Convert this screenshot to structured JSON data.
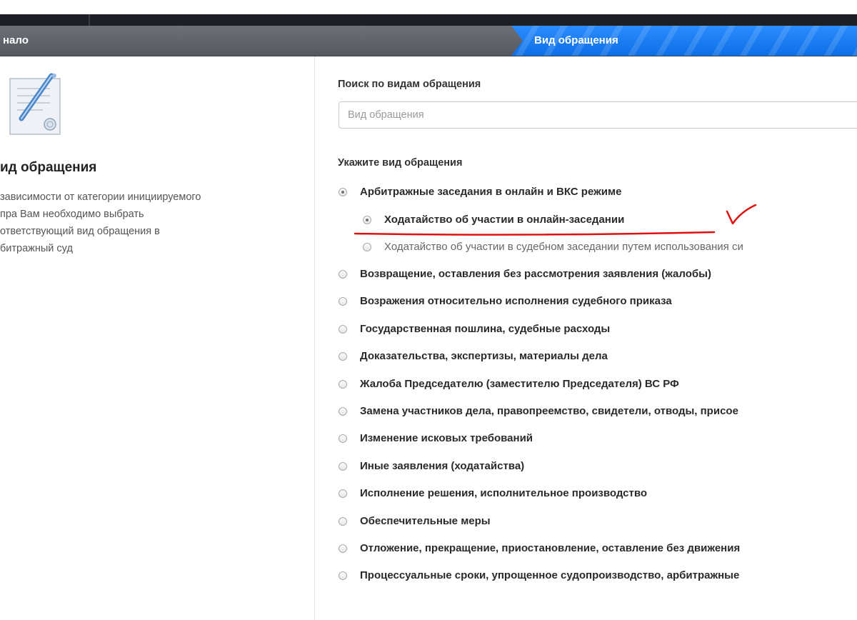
{
  "wizard": {
    "step_start": "нало",
    "step_active": "Вид обращения"
  },
  "left_panel": {
    "title": "ид обращения",
    "description_lines": [
      "зависимости от категории инициируемого",
      "пра Вам необходимо выбрать",
      "ответствующий вид обращения в",
      "битражный суд"
    ],
    "icon": "document-pen-icon"
  },
  "search": {
    "label": "Поиск по видам обращения",
    "placeholder": "Вид обращения",
    "value": ""
  },
  "selection": {
    "label": "Укажите вид обращения",
    "options": [
      {
        "label": "Арбитражные заседания в онлайн и ВКС режиме",
        "level": 0,
        "checked": true
      },
      {
        "label": "Ходатайство об участии в онлайн-заседании",
        "level": 1,
        "checked": true
      },
      {
        "label": "Ходатайство об участии в судебном заседании путем использования си",
        "level": 1,
        "checked": false
      },
      {
        "label": "Возвращение, оставления без рассмотрения заявления (жалобы)",
        "level": 0,
        "checked": false
      },
      {
        "label": "Возражения относительно исполнения судебного приказа",
        "level": 0,
        "checked": false
      },
      {
        "label": "Государственная пошлина, судебные расходы",
        "level": 0,
        "checked": false
      },
      {
        "label": "Доказательства, экспертизы, материалы дела",
        "level": 0,
        "checked": false
      },
      {
        "label": "Жалоба Председателю (заместителю Председателя) ВС РФ",
        "level": 0,
        "checked": false
      },
      {
        "label": "Замена участников дела, правопреемство, свидетели, отводы, присое",
        "level": 0,
        "checked": false
      },
      {
        "label": "Изменение исковых требований",
        "level": 0,
        "checked": false
      },
      {
        "label": "Иные заявления (ходатайства)",
        "level": 0,
        "checked": false
      },
      {
        "label": "Исполнение решения, исполнительное производство",
        "level": 0,
        "checked": false
      },
      {
        "label": "Обеспечительные меры",
        "level": 0,
        "checked": false
      },
      {
        "label": "Отложение, прекращение, приостановление, оставление без движения",
        "level": 0,
        "checked": false
      },
      {
        "label": "Процессуальные сроки, упрощенное судопроизводство, арбитражные",
        "level": 0,
        "checked": false
      }
    ]
  },
  "colors": {
    "active_step": "#1a7cf5",
    "annotation": "#e01010"
  }
}
